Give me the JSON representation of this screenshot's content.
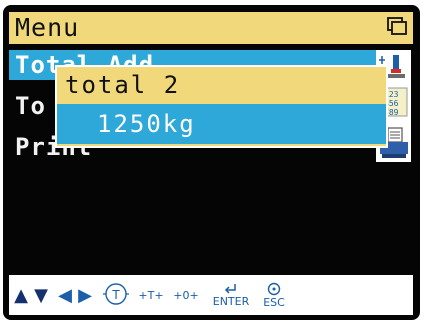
{
  "title_bar": {
    "title": "Menu",
    "window_icon": "window-icon"
  },
  "menu": {
    "items": [
      {
        "label": "Total Add",
        "selected": true
      },
      {
        "label": "To",
        "selected": false
      },
      {
        "label": "Print",
        "selected": false
      }
    ]
  },
  "popup": {
    "title": "total 2",
    "value": "1250kg"
  },
  "side_icons": [
    "scale-icon",
    "number-pad-icon",
    "printer-icon"
  ],
  "keybar": {
    "keys": [
      {
        "name": "up",
        "glyph": "▲"
      },
      {
        "name": "down",
        "glyph": "▼"
      },
      {
        "name": "left",
        "glyph": "◀"
      },
      {
        "name": "right",
        "glyph": "▶"
      },
      {
        "name": "tare",
        "glyph": "T"
      },
      {
        "name": "tare-plus",
        "glyph": "+T+"
      },
      {
        "name": "zero",
        "glyph": "+0+"
      },
      {
        "name": "enter",
        "glyph": "ENTER"
      },
      {
        "name": "esc",
        "glyph": "ESC"
      }
    ]
  },
  "colors": {
    "highlight": "#2ea7d9",
    "title_bar": "#f1d97b",
    "background": "#050505",
    "key_blue": "#1c5ea8"
  }
}
